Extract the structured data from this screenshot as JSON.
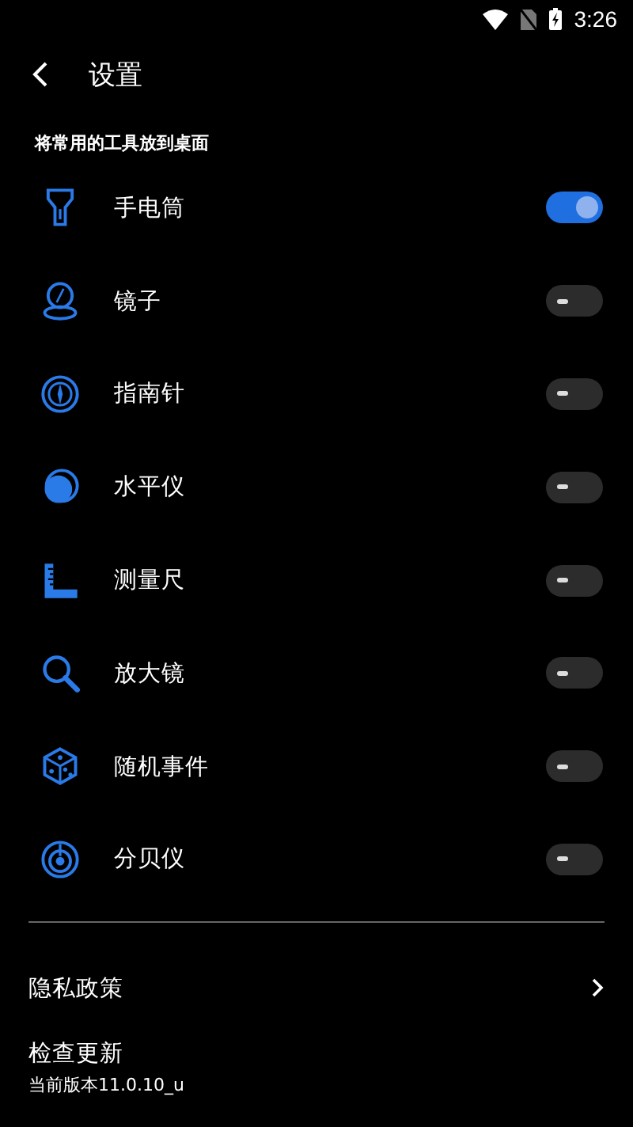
{
  "status_bar": {
    "time": "3:26"
  },
  "header": {
    "title": "设置"
  },
  "section": {
    "title": "将常用的工具放到桌面"
  },
  "tools": [
    {
      "label": "手电筒",
      "on": true
    },
    {
      "label": "镜子",
      "on": false
    },
    {
      "label": "指南针",
      "on": false
    },
    {
      "label": "水平仪",
      "on": false
    },
    {
      "label": "测量尺",
      "on": false
    },
    {
      "label": "放大镜",
      "on": false
    },
    {
      "label": "随机事件",
      "on": false
    },
    {
      "label": "分贝仪",
      "on": false
    }
  ],
  "privacy": {
    "label": "隐私政策"
  },
  "update": {
    "label": "检查更新",
    "version": "当前版本11.0.10_u"
  }
}
